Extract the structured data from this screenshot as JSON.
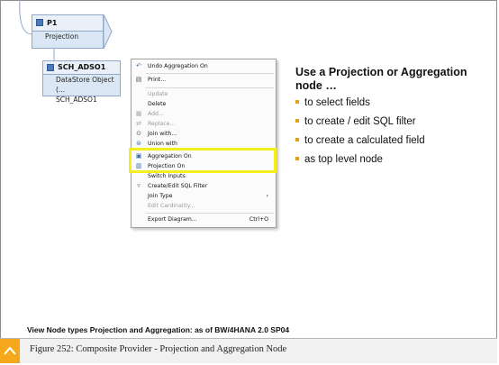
{
  "projection_node": {
    "name": "P1",
    "type": "Projection"
  },
  "adso_node": {
    "name": "SCH_ADSO1",
    "line1": "DataStore Object (...",
    "line2": "SCH_ADSO1"
  },
  "context_menu": {
    "items": [
      {
        "label": "Undo Aggregation On",
        "icon": "undo-icon",
        "disabled": false
      },
      {
        "label": "Print...",
        "icon": "print-icon",
        "disabled": false
      },
      {
        "label": "Update",
        "icon": "",
        "disabled": true
      },
      {
        "label": "Delete",
        "icon": "",
        "disabled": false
      },
      {
        "label": "Add...",
        "icon": "add-icon",
        "disabled": true
      },
      {
        "label": "Replace...",
        "icon": "replace-icon",
        "disabled": true
      },
      {
        "label": "Join with...",
        "icon": "join-icon",
        "disabled": false
      },
      {
        "label": "Union with",
        "icon": "union-icon",
        "disabled": false
      },
      {
        "label": "Aggregation On",
        "icon": "aggregation-icon",
        "disabled": false
      },
      {
        "label": "Projection On",
        "icon": "projection-icon",
        "disabled": false
      },
      {
        "label": "Switch Inputs",
        "icon": "",
        "disabled": false
      },
      {
        "label": "Create/Edit SQL Filter",
        "icon": "filter-icon",
        "disabled": false
      },
      {
        "label": "Join Type",
        "icon": "",
        "disabled": false,
        "submenu": "›"
      },
      {
        "label": "Edit Cardinality...",
        "icon": "",
        "disabled": true
      },
      {
        "label": "Export Diagram...",
        "icon": "",
        "disabled": false,
        "shortcut": "Ctrl+O"
      }
    ],
    "highlight_color": "#f4ef1a"
  },
  "slide": {
    "title": "Use a Projection or Aggregation node …",
    "bullets": [
      "to select fields",
      "to create / edit SQL filter",
      "to create a calculated field",
      "as top level node"
    ],
    "bullet_color": "#e6a013",
    "note": "View Node types Projection and Aggregation: as of BW/4HANA 2.0 SP04"
  },
  "caption": {
    "text": "Figure 252: Composite Provider - Projection and Aggregation Node",
    "accent": "#f5a81c"
  }
}
